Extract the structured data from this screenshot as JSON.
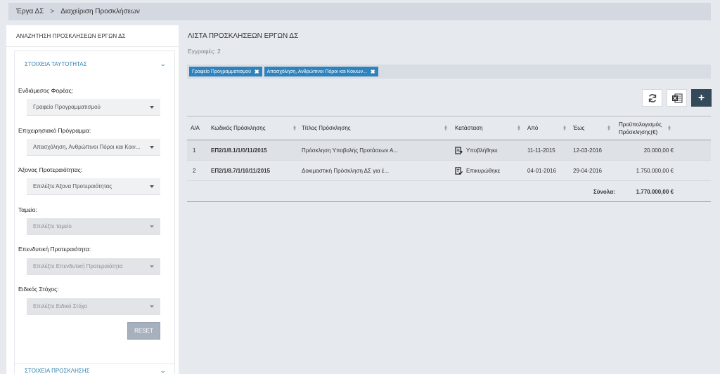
{
  "breadcrumb": {
    "home": "Έργα ΔΣ",
    "sep": ">",
    "current": "Διαχείριση Προσκλήσεων"
  },
  "sidebar": {
    "title": "ΑΝΑΖΗΤΗΣΗ ΠΡΟΣΚΛΗΣΕΩΝ ΕΡΓΩΝ ΔΣ",
    "panel1_title": "ΣΤΟΙΧΕΙΑ ΤΑΥΤΟΤΗΤΑΣ",
    "panel2_title": "ΣΤΟΙΧΕΙΑ ΠΡΟΣΚΛΗΣΗΣ",
    "fields": [
      {
        "label": "Ενδιάμεσος Φορέας:",
        "value": "Γραφείο Προγραμματισμού",
        "disabled": false
      },
      {
        "label": "Επιχειρησιακό Πρόγραμμα:",
        "value": "Απασχόληση, Ανθρώπινοι Πόροι και Κοιν...",
        "disabled": false
      },
      {
        "label": "Άξονας Προτεραιότητας:",
        "value": "Επιλέξτε Άξονα Προτεραιότητας",
        "disabled": false
      },
      {
        "label": "Ταμείο:",
        "value": "Επιλέξτε ταμείο",
        "disabled": true
      },
      {
        "label": "Επενδυτική Προτεραιότητα:",
        "value": "Επιλέξτε Επενδυτική Προτεραιότητα",
        "disabled": true
      },
      {
        "label": "Ειδικός Στόχος:",
        "value": "Επιλέξτε Ειδικό Στόχο",
        "disabled": true
      }
    ],
    "reset_label": "RESET"
  },
  "main": {
    "title": "ΛΙΣΤΑ ΠΡΟΣΚΛΗΣΕΩΝ ΕΡΓΩΝ ΔΣ",
    "records": "Εγγραφές: 2",
    "chips": [
      {
        "label": "Γραφείο Προγραμματισμού",
        "x": "✖"
      },
      {
        "label": "Απασχόληση, Ανθρώπινοι Πόροι και Κοινων...",
        "x": "✖"
      }
    ],
    "add_icon": "+",
    "columns": [
      "Α/Α",
      "Κωδικός Πρόσκλησης",
      "Τίτλος Πρόσκλησης",
      "Κατάσταση",
      "Από",
      "Έως",
      "Προϋπολογισμός",
      "Πρόσκλησης(€)"
    ],
    "rows": [
      {
        "aa": "1",
        "code": "ΕΠ2/1/8.1/1/0/11/2015",
        "title": "Πρόσκληση Υποβολής Προτάσεων Α...",
        "status": "Υποβλήθηκε",
        "from": "11-11-2015",
        "to": "12-03-2016",
        "budget": "20.000,00 €"
      },
      {
        "aa": "2",
        "code": "ΕΠ2/1/8.7/1/10/11/2015",
        "title": "Δοκιμαστική Πρόσκληση ΔΣ για έ...",
        "status": "Επικυρώθηκε",
        "from": "04-01-2016",
        "to": "29-04-2016",
        "budget": "1.750.000,00 €"
      }
    ],
    "totals_label": "Σύνολα:",
    "totals_value": "1.770.000,00 €"
  }
}
